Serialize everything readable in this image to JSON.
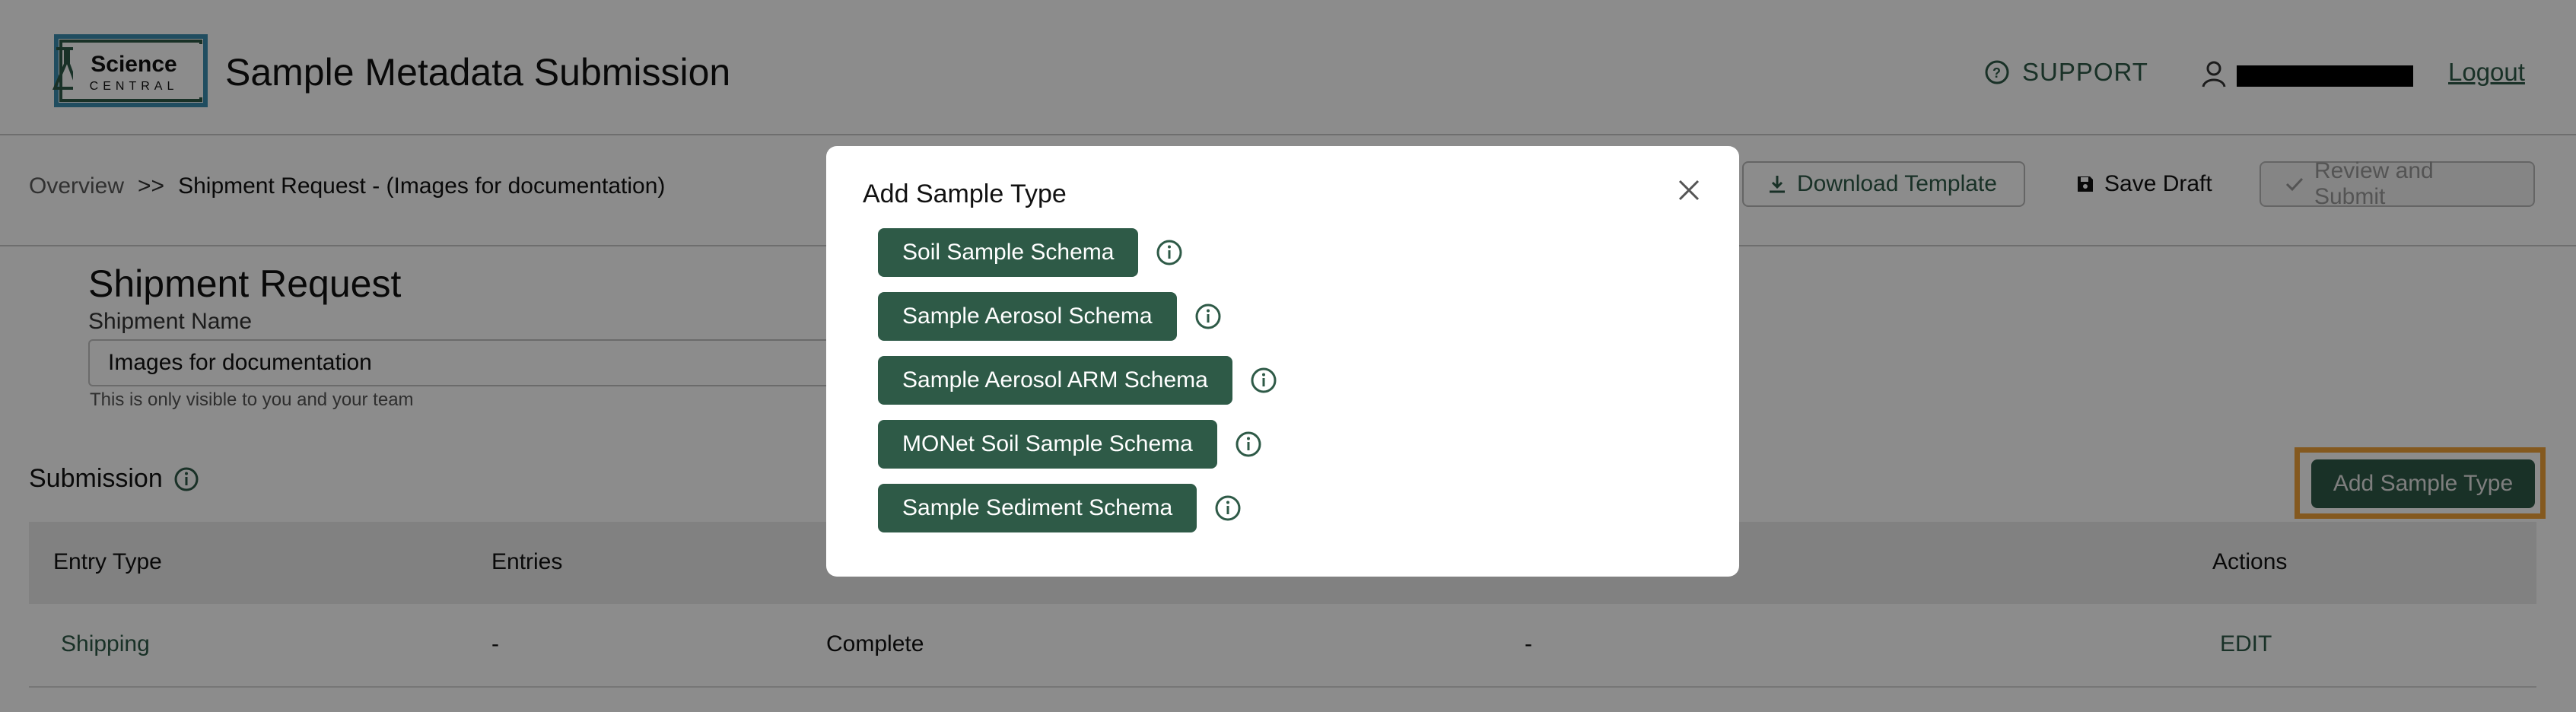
{
  "app": {
    "logo_word": "Science",
    "logo_sub": "CENTRAL",
    "title": "Sample Metadata Submission"
  },
  "header": {
    "support_label": "SUPPORT",
    "logout_label": "Logout"
  },
  "breadcrumb": {
    "items": [
      "Overview",
      ">>",
      "Shipment Request - (Images for documentation)"
    ]
  },
  "toolbar": {
    "download_label": "Download Template",
    "save_label": "Save Draft",
    "review_label": "Review and Submit"
  },
  "shipment": {
    "section_title": "Shipment Request",
    "name_label": "Shipment Name",
    "name_value": "Images for documentation",
    "help_text": "This is only visible to you and your team"
  },
  "submission": {
    "title": "Submission",
    "add_button": "Add Sample Type",
    "columns": [
      "Entry Type",
      "Entries",
      "",
      "",
      "Actions"
    ],
    "rows": [
      {
        "entry_type": "Shipping",
        "entries": "-",
        "status": "Complete",
        "note": "-",
        "action": "EDIT"
      }
    ]
  },
  "modal": {
    "title": "Add Sample Type",
    "options": [
      "Soil Sample Schema",
      "Sample Aerosol Schema",
      "Sample Aerosol ARM Schema",
      "MONet Soil Sample Schema",
      "Sample Sediment Schema"
    ]
  },
  "colors": {
    "primary": "#2e5a47",
    "highlight": "#f0a23a",
    "overlay": "rgba(0,0,0,0.45)"
  }
}
